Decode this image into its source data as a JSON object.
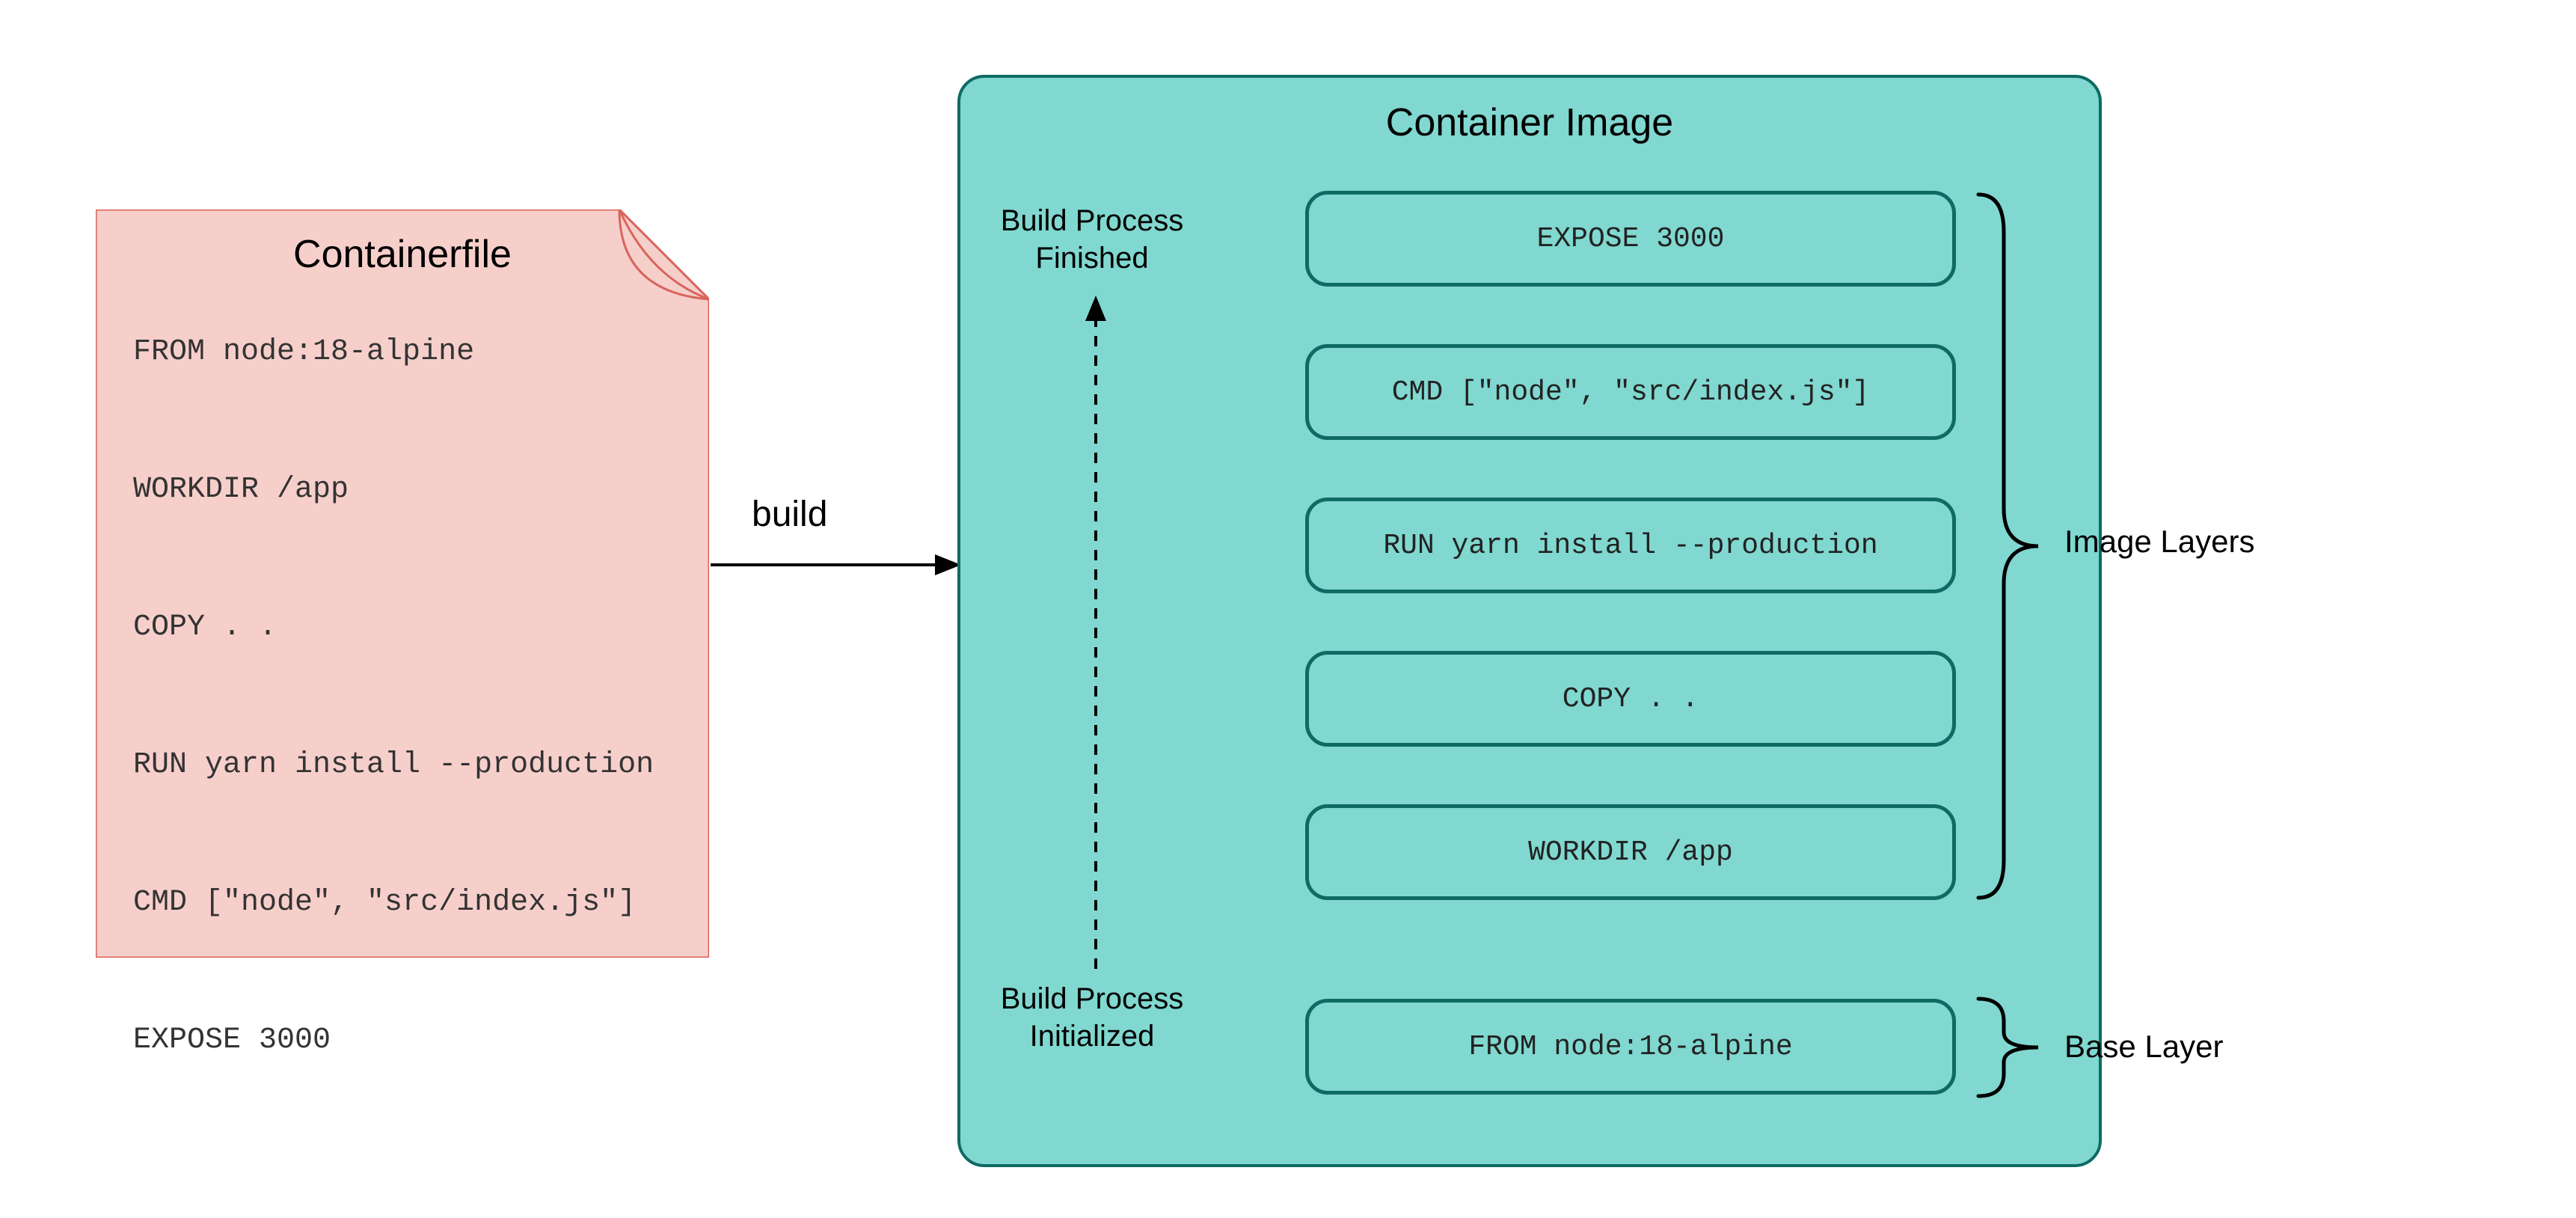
{
  "note": {
    "title": "Containerfile",
    "code": "FROM node:18-alpine\n\nWORKDIR /app\n\nCOPY . .\n\nRUN yarn install --production\n\nCMD [\"node\", \"src/index.js\"]\n\nEXPOSE 3000"
  },
  "arrow_label": "build",
  "container_image": {
    "title": "Container Image",
    "layers_top_to_bottom": [
      "EXPOSE 3000",
      "CMD [\"node\", \"src/index.js\"]",
      "RUN yarn install --production",
      "COPY . .",
      "WORKDIR /app",
      "FROM node:18-alpine"
    ],
    "process_finished_label": "Build Process\nFinished",
    "process_initialized_label": "Build Process\nInitialized",
    "image_layers_label": "Image Layers",
    "base_layer_label": "Base Layer"
  },
  "colors": {
    "note_fill": "#f6cfcb",
    "note_stroke": "#d9655c",
    "image_fill": "#80d8d0",
    "image_stroke": "#0e6b63"
  }
}
